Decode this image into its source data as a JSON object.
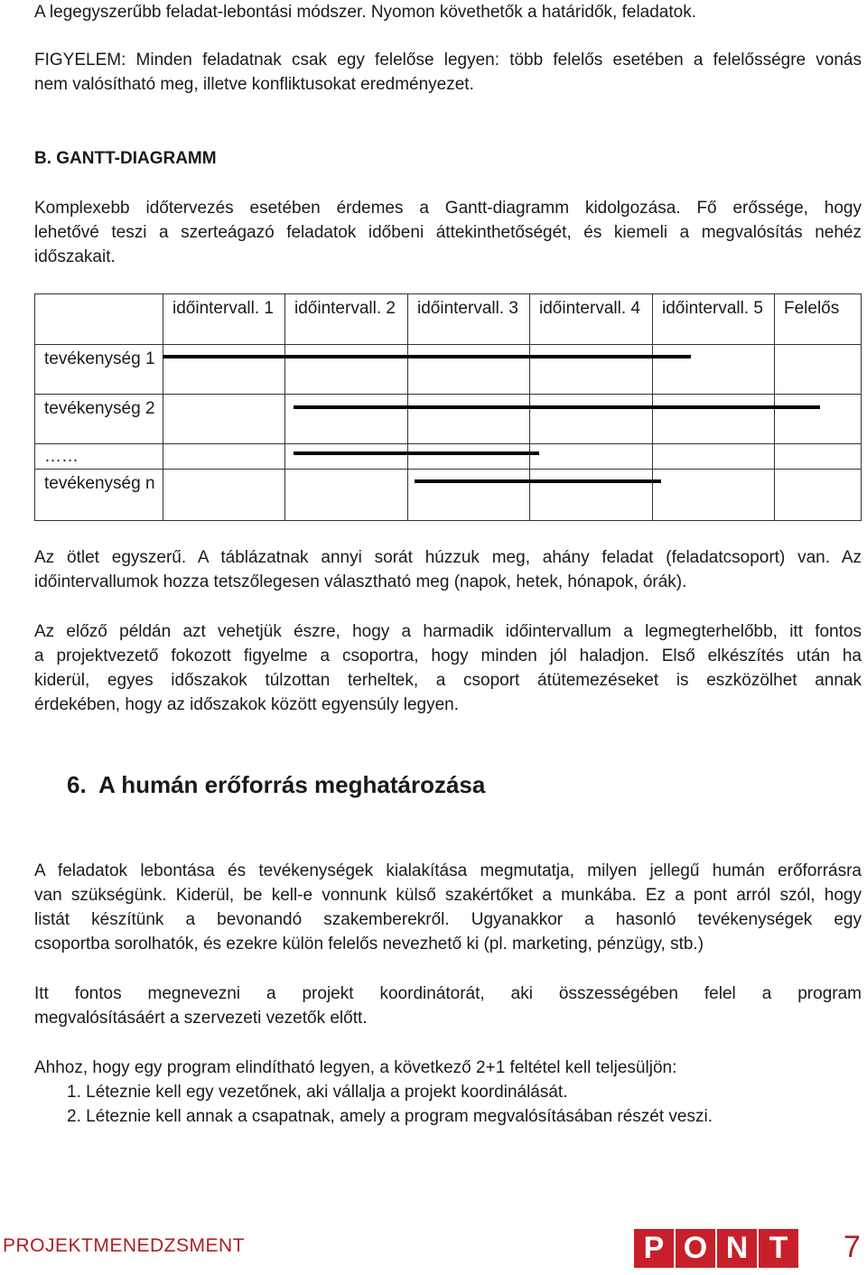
{
  "intro": {
    "line1": "A legegyszerűbb feladat-lebontási módszer. Nyomon követhetők a határidők, feladatok.",
    "warning": [
      "FIGYELEM: Minden feladatnak csak egy felelőse legyen: több felelős esetében a felelősségre vonás",
      "nem valósítható meg, illetve konfliktusokat eredményezet."
    ]
  },
  "gantt_heading": "B. GANTT-DIAGRAMM",
  "gantt_intro": [
    "Komplexebb időtervezés esetében érdemes a Gantt-diagramm kidolgozása. Fő erőssége, hogy",
    "lehetővé teszi a szerteágazó feladatok időbeni áttekinthetőségét, és kiemeli a megvalósítás nehéz",
    "időszakait."
  ],
  "table": {
    "headers": [
      "",
      "időintervall. 1",
      "időintervall. 2",
      "időintervall. 3",
      "időintervall. 4",
      "időintervall. 5",
      "Felelős"
    ],
    "rows": [
      {
        "label": "tevékenység 1",
        "span": [
          1,
          5
        ]
      },
      {
        "label": "tevékenység 2",
        "span": [
          2,
          6
        ]
      },
      {
        "label": "……",
        "span": [
          2,
          3
        ]
      },
      {
        "label": "tevékenység n",
        "span": [
          3,
          4
        ]
      }
    ]
  },
  "para1": [
    "Az ötlet egyszerű. A táblázatnak annyi sorát húzzuk meg, ahány feladat (feladatcsoport) van. Az",
    "időintervallumok hozza tetszőlegesen választható meg (napok, hetek, hónapok, órák)."
  ],
  "para2": [
    "Az előző példán azt vehetjük észre, hogy a harmadik időintervallum a legmegterhelőbb, itt fontos",
    "a projektvezető fokozott figyelme a csoportra, hogy minden jól haladjon. Első elkészítés után ha",
    "kiderül, egyes időszakok túlzottan terheltek, a csoport átütemezéseket is eszközölhet annak",
    "érdekében, hogy az időszakok között egyensúly legyen."
  ],
  "section_heading": "6.  A humán erőforrás meghatározása",
  "para3": [
    "A feladatok lebontása és tevékenységek kialakítása megmutatja, milyen jellegű humán erőforrásra",
    "van szükségünk. Kiderül, be kell-e vonnunk külső szakértőket a munkába. Ez a pont arról szól, hogy",
    "listát készítünk a bevonandó szakemberekről. Ugyanakkor a hasonló tevékenységek egy",
    "csoportba sorolhatók, és ezekre külön felelős nevezhető ki (pl. marketing, pénzügy, stb.)"
  ],
  "para4": [
    "Itt fontos megnevezni a projekt koordinátorát, aki összességében felel a program",
    "megvalósításáért a szervezeti vezetők előtt."
  ],
  "para5": "Ahhoz, hogy egy program elindítható legyen, a következő 2+1 feltétel kell teljesüljön:",
  "list": [
    "1. Léteznie kell egy vezetőnek, aki vállalja a projekt koordinálását.",
    "2. Léteznie kell annak a csapatnak, amely a program megvalósításában részét veszi."
  ],
  "footer": {
    "title": "PROJEKTMENEDZSMENT",
    "logo": [
      "P",
      "O",
      "N",
      "T"
    ],
    "page": "7",
    "accent": "#c8202a"
  }
}
